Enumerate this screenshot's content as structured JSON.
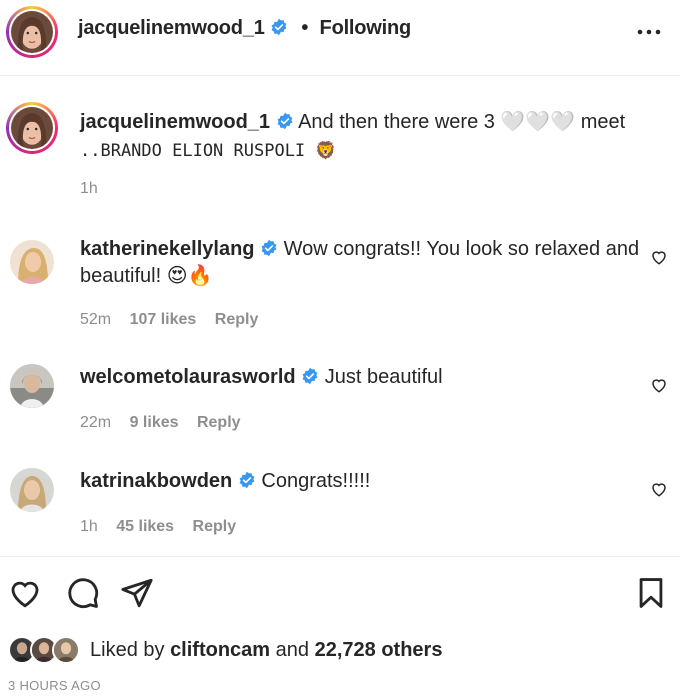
{
  "header": {
    "username": "jacquelinemwood_1",
    "separator": "•",
    "follow_status": "Following",
    "more_icon": "more-horizontal-icon"
  },
  "caption": {
    "username": "jacquelinemwood_1",
    "text_line1": "And then there were 3 🤍🤍🤍 meet",
    "text_line2": "..BRANDO ELION RUSPOLI 🦁",
    "time": "1h"
  },
  "comments": [
    {
      "username": "katherinekellylang",
      "text": "Wow congrats!! You look so relaxed and beautiful! 😍🔥",
      "time": "52m",
      "likes": "107 likes",
      "reply": "Reply"
    },
    {
      "username": "welcometolaurasworld",
      "text": "Just beautiful",
      "time": "22m",
      "likes": "9 likes",
      "reply": "Reply"
    },
    {
      "username": "katrinakbowden",
      "text": "Congrats!!!!!",
      "time": "1h",
      "likes": "45 likes",
      "reply": "Reply"
    }
  ],
  "actions": {
    "like_icon": "heart-icon",
    "comment_icon": "comment-icon",
    "share_icon": "send-icon",
    "save_icon": "bookmark-icon"
  },
  "likes": {
    "prefix": "Liked by",
    "user": "cliftoncam",
    "middle": "and",
    "others": "22,728 others"
  },
  "timestamp": "3 HOURS AGO",
  "colors": {
    "text": "#262626",
    "muted": "#8e8e8e",
    "verified": "#3897f0",
    "divider": "#efefef"
  }
}
